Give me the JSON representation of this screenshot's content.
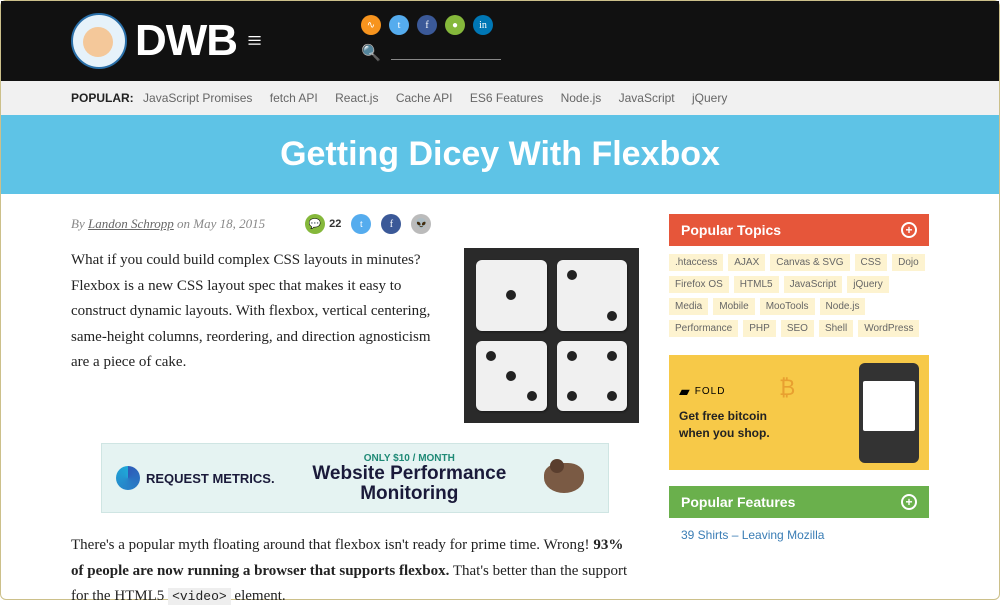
{
  "header": {
    "logo_text": "DWB"
  },
  "popular": {
    "label": "POPULAR:",
    "items": [
      "JavaScript Promises",
      "fetch API",
      "React.js",
      "Cache API",
      "ES6 Features",
      "Node.js",
      "JavaScript",
      "jQuery"
    ]
  },
  "title": "Getting Dicey With Flexbox",
  "byline": {
    "by": "By ",
    "author": "Landon Schropp",
    "on": " on ",
    "date": "May 18, 2015",
    "comments": "22"
  },
  "intro": "What if you could build complex CSS layouts in minutes? Flexbox is a new CSS layout spec that makes it easy to construct dynamic layouts. With flexbox, vertical centering, same-height columns, reordering, and direction agnosticism are a piece of cake.",
  "ad1": {
    "brand": "REQUEST METRICS.",
    "tag": "ONLY $10 / MONTH",
    "line1": "Website Performance",
    "line2": "Monitoring"
  },
  "para2": {
    "t1": "There's a popular myth floating around that flexbox isn't ready for prime time. Wrong! ",
    "bold": "93% of people are now running a browser that supports flexbox.",
    "t2": " That's better than the support for the HTML5 ",
    "code": "<video>",
    "t3": " element."
  },
  "sidebar": {
    "topics_title": "Popular Topics",
    "tags": [
      ".htaccess",
      "AJAX",
      "Canvas & SVG",
      "CSS",
      "Dojo",
      "Firefox OS",
      "HTML5",
      "JavaScript",
      "jQuery",
      "Media",
      "Mobile",
      "MooTools",
      "Node.js",
      "Performance",
      "PHP",
      "SEO",
      "Shell",
      "WordPress"
    ],
    "fold": {
      "brand": "FOLD",
      "line1": "Get free bitcoin",
      "line2": "when you shop."
    },
    "features_title": "Popular Features",
    "feature1": "39 Shirts – Leaving Mozilla"
  }
}
